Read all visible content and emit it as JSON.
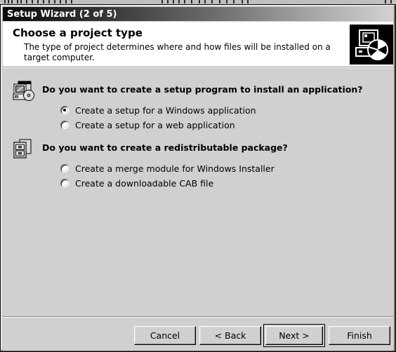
{
  "window": {
    "title": "Setup Wizard (2 of 5)"
  },
  "header": {
    "title": "Choose a project type",
    "description": "The type of project determines where and how files will be installed on a target computer.",
    "icon": "computer-piechart-icon"
  },
  "body": {
    "groups": [
      {
        "icon": "computer-cd-icon",
        "question": "Do you want to create a setup program to install an application?",
        "options": [
          {
            "label": "Create a setup for a Windows application",
            "checked": true
          },
          {
            "label": "Create a setup for a web application",
            "checked": false
          }
        ]
      },
      {
        "icon": "package-modules-icon",
        "question": "Do you want to create a redistributable package?",
        "options": [
          {
            "label": "Create a merge module for Windows Installer",
            "checked": false
          },
          {
            "label": "Create a downloadable CAB file",
            "checked": false
          }
        ]
      }
    ]
  },
  "footer": {
    "buttons": [
      {
        "label": "Cancel",
        "default": false
      },
      {
        "label": "< Back",
        "default": false
      },
      {
        "label": "Next >",
        "default": true
      },
      {
        "label": "Finish",
        "default": false
      }
    ]
  },
  "colors": {
    "dialog_face": "#d0d0d0",
    "header_background": "#ffffff",
    "titlebar_start": "#0a0a0a",
    "titlebar_end": "#d2d2d2",
    "text": "#000000",
    "titlebar_text": "#ffffff"
  }
}
